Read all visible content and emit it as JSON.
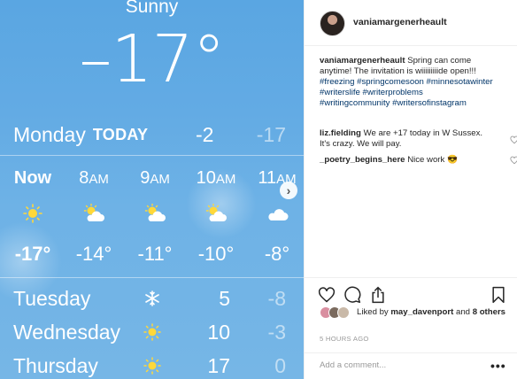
{
  "weather": {
    "condition": "Sunny",
    "current_temp": "–17°",
    "today": {
      "day": "Monday",
      "tag": "TODAY",
      "high": "-2",
      "low": "-17"
    },
    "hourly": [
      {
        "time": "Now",
        "ampm": "",
        "icon": "sun-icon",
        "temp": "-17°",
        "now": true
      },
      {
        "time": "8",
        "ampm": "AM",
        "icon": "partly-cloudy-icon",
        "temp": "-14°"
      },
      {
        "time": "9",
        "ampm": "AM",
        "icon": "partly-cloudy-icon",
        "temp": "-11°"
      },
      {
        "time": "10",
        "ampm": "AM",
        "icon": "partly-cloudy-icon",
        "temp": "-10°"
      },
      {
        "time": "11",
        "ampm": "AM",
        "icon": "cloud-icon",
        "temp": "-8°"
      }
    ],
    "daily": [
      {
        "day": "Tuesday",
        "icon": "snowflake-icon",
        "high": "5",
        "low": "-8"
      },
      {
        "day": "Wednesday",
        "icon": "sun-icon",
        "high": "10",
        "low": "-3"
      },
      {
        "day": "Thursday",
        "icon": "sun-icon",
        "high": "17",
        "low": "0"
      }
    ]
  },
  "post": {
    "username": "vaniamargenerheault",
    "caption": {
      "user": "vaniamargenerheault",
      "text": "Spring can come anytime! The invitation is wiiiiiiiiide open!!!",
      "tags": "#freezing #springcomesoon #minnesotawinter #writerslife #writerproblems #writingcommunity #writersofinstagram"
    },
    "comments": [
      {
        "user": "liz.fielding",
        "text": "We are +17 today in W Sussex. It's crazy. We will pay."
      },
      {
        "user": "_poetry_begins_here",
        "text": "Nice work 😎"
      }
    ],
    "likes": {
      "prefix": "Liked by",
      "user": "may_davenport",
      "and": "and",
      "others": "8 others"
    },
    "time_ago": "5 HOURS AGO",
    "add_comment_placeholder": "Add a comment...",
    "more_label": "•••"
  },
  "colors": {
    "sky_top": "#5aa6e2",
    "sky_bottom": "#76b6e6",
    "sun": "#ffd83a",
    "link": "#003569"
  }
}
